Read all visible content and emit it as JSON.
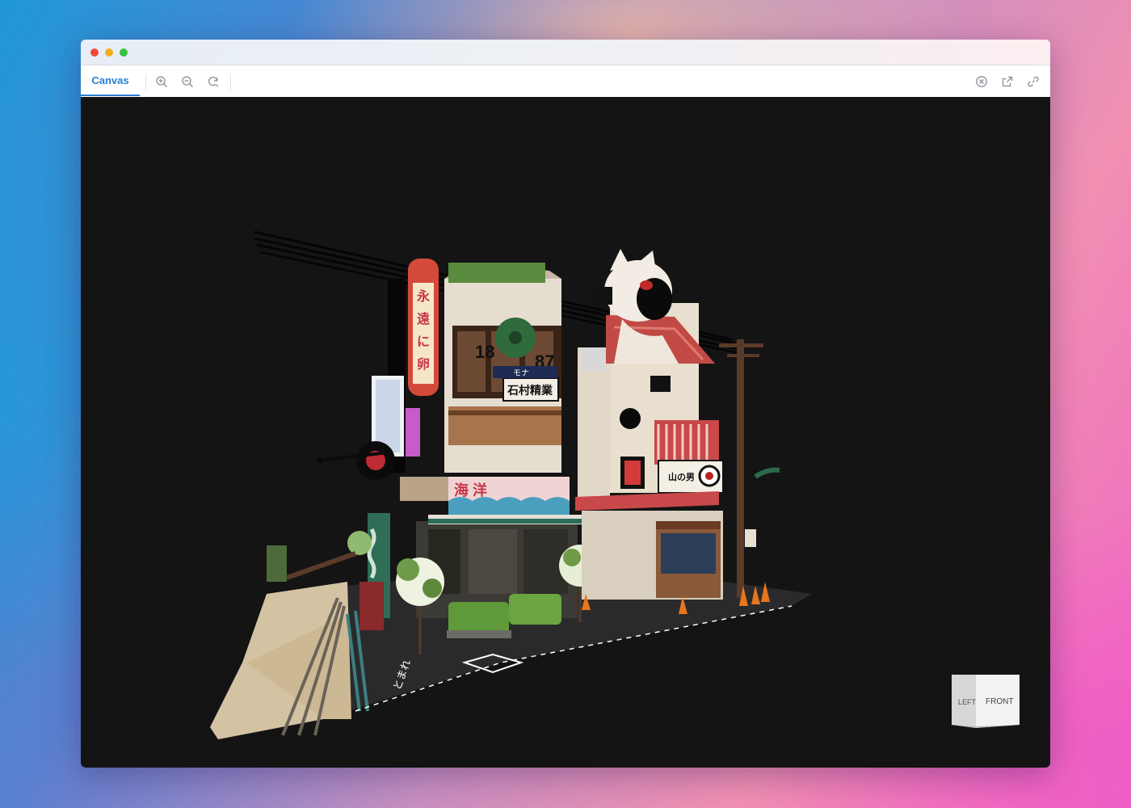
{
  "window": {
    "traffic_lights": {
      "close": "#f2473d",
      "minimize": "#f5b019",
      "maximize": "#36c13e"
    }
  },
  "toolbar": {
    "tab_label": "Canvas",
    "accent": "#2b7fd4",
    "buttons": {
      "zoom_in": "zoom-in-icon",
      "zoom_out": "zoom-out-icon",
      "reset": "reset-view-icon",
      "close": "close-circle-icon",
      "open_external": "external-link-icon",
      "copy_link": "link-icon"
    }
  },
  "scene": {
    "signs": {
      "vertical_sign": "永遠に卵",
      "year_left": "18",
      "year_right": "87",
      "store_sign": "石村精業",
      "awning_sign": "海 洋",
      "side_sign": "山の男",
      "banner": "モナ"
    },
    "road_marking": "とまれ"
  },
  "view_cube": {
    "left": "LEFT",
    "front": "FRONT"
  }
}
